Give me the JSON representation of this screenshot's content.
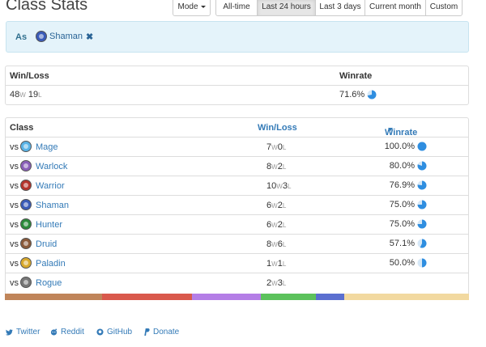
{
  "title": "Class Stats",
  "mode_button": "Mode",
  "time_filters": [
    {
      "label": "All-time",
      "width": 52
    },
    {
      "label": "Last 24 hours",
      "width": 73,
      "active": true
    },
    {
      "label": "Last 3 days",
      "width": 62
    },
    {
      "label": "Current month",
      "width": 76
    },
    {
      "label": "Custom",
      "width": 46
    }
  ],
  "filter": {
    "as": "As",
    "class": "Shaman"
  },
  "summary": {
    "wl_header": "Win/Loss",
    "winrate_header": "Winrate",
    "wins": "48",
    "w": "W",
    "losses": "19",
    "l": "L",
    "winrate": "71.6%",
    "winrate_value": 71.6
  },
  "table": {
    "headers": {
      "class": "Class",
      "winloss": "Win/Loss",
      "winrate": "Winrate"
    },
    "vs": "vs",
    "rows": [
      {
        "name": "Mage",
        "wins": "7",
        "losses": "0",
        "winrate": "100.0%",
        "value": 100.0,
        "color": "#5ab3e6"
      },
      {
        "name": "Warlock",
        "wins": "8",
        "losses": "2",
        "winrate": "80.0%",
        "value": 80.0,
        "color": "#8a5fb8"
      },
      {
        "name": "Warrior",
        "wins": "10",
        "losses": "3",
        "winrate": "76.9%",
        "value": 76.9,
        "color": "#b5342c"
      },
      {
        "name": "Shaman",
        "wins": "6",
        "losses": "2",
        "winrate": "75.0%",
        "value": 75.0,
        "color": "#3a5bb8"
      },
      {
        "name": "Hunter",
        "wins": "6",
        "losses": "2",
        "winrate": "75.0%",
        "value": 75.0,
        "color": "#2c8a3a"
      },
      {
        "name": "Druid",
        "wins": "8",
        "losses": "6",
        "winrate": "57.1%",
        "value": 57.1,
        "color": "#8a5a3a"
      },
      {
        "name": "Paladin",
        "wins": "1",
        "losses": "1",
        "winrate": "50.0%",
        "value": 50.0,
        "color": "#d9a92c"
      },
      {
        "name": "Rogue",
        "wins": "2",
        "losses": "3",
        "winrate": "",
        "value": null,
        "color": "#777777"
      }
    ]
  },
  "class_bar": [
    {
      "color": "#c0855a",
      "share": 120
    },
    {
      "color": "#d9594c",
      "share": 111
    },
    {
      "color": "#b47ee6",
      "share": 85
    },
    {
      "color": "#5cc25c",
      "share": 68
    },
    {
      "color": "#5b6fd0",
      "share": 35
    },
    {
      "color": "#f2d9a0",
      "share": 154
    }
  ],
  "footer": [
    {
      "label": "Twitter",
      "icon": "twitter-icon"
    },
    {
      "label": "Reddit",
      "icon": "reddit-icon"
    },
    {
      "label": "GitHub",
      "icon": "github-icon"
    },
    {
      "label": "Donate",
      "icon": "paypal-icon"
    }
  ],
  "colors": {
    "link": "#337ab7",
    "pie": "#2f8ee0",
    "alert_bg": "#e4f3fa"
  }
}
